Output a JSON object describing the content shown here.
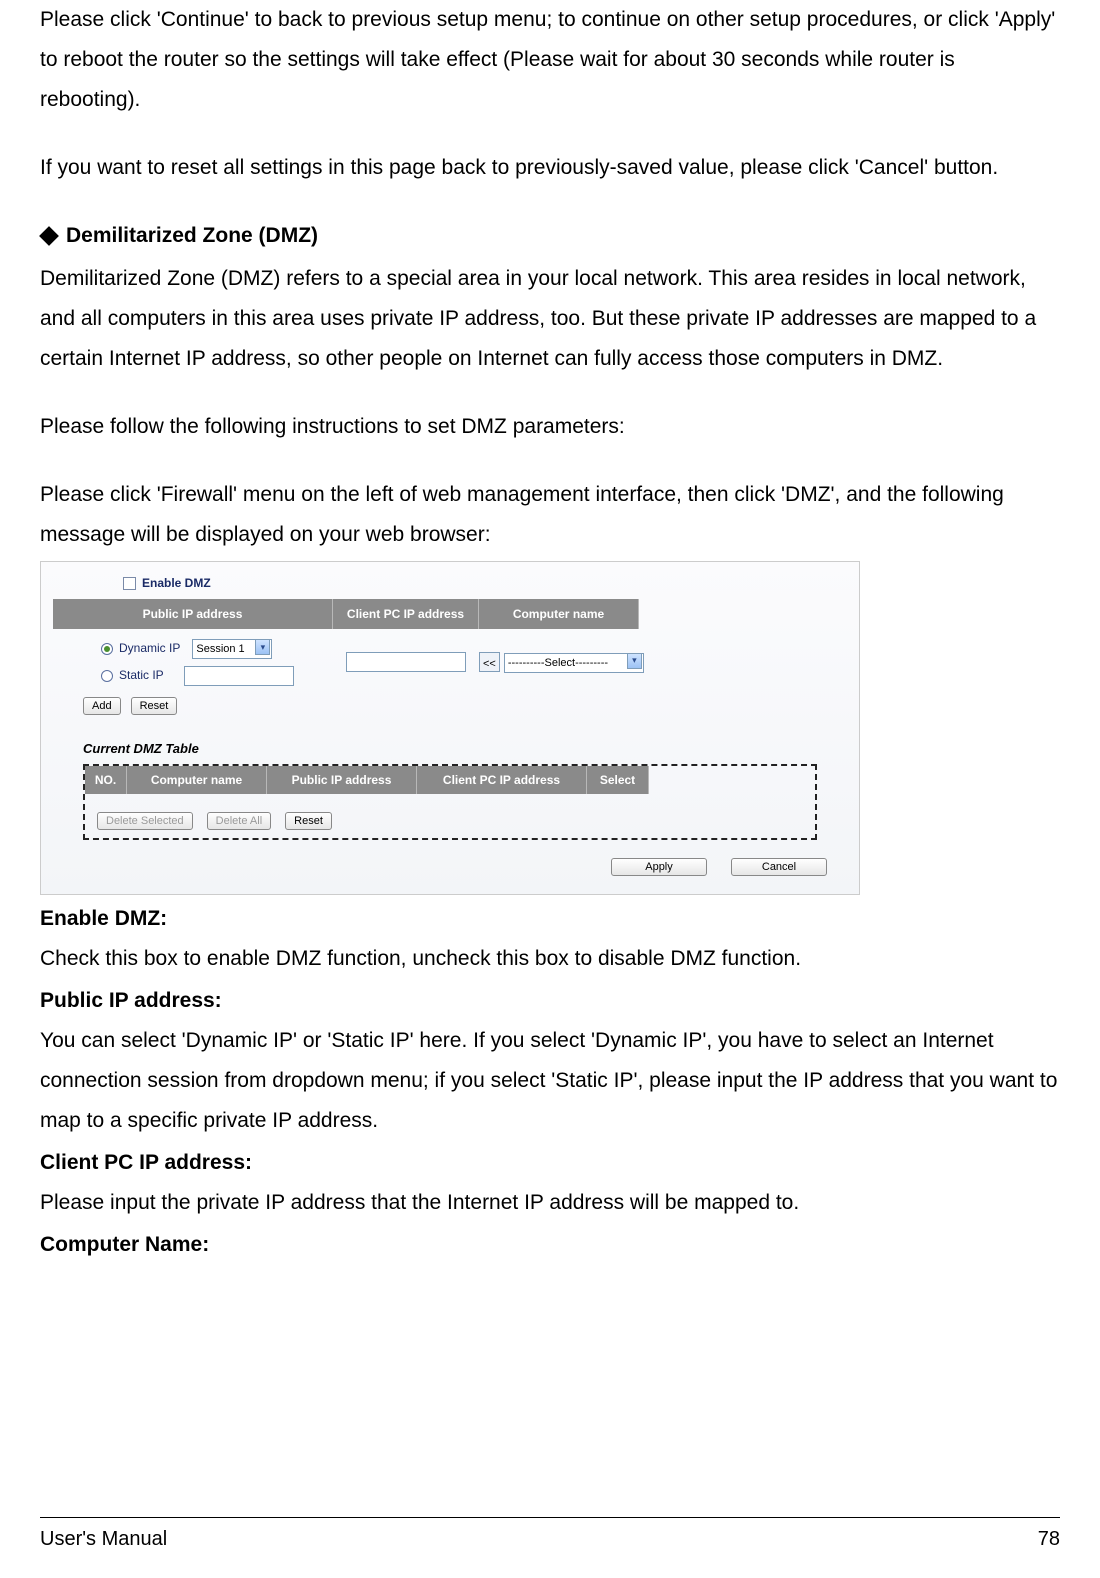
{
  "paragraphs": {
    "p1": "Please click 'Continue' to back to previous setup menu; to continue on other setup procedures, or click 'Apply' to reboot the router so the settings will take effect (Please wait for about 30 seconds while router is rebooting).",
    "p2": "If you want to reset all settings in this page back to previously-saved value, please click 'Cancel' button.",
    "dmz_title": "Demilitarized Zone (DMZ)",
    "dmz_desc": "Demilitarized Zone (DMZ) refers to a special area in your local network. This area resides in local network, and all computers in this area uses private IP address, too. But these private IP addresses are mapped to a certain Internet IP address, so other people on Internet can fully access those computers in DMZ.",
    "dmz_instr1": "Please follow the following instructions to set DMZ parameters:",
    "dmz_instr2": "Please click 'Firewall' menu on the left of web management interface, then click 'DMZ', and the following message will be displayed on your web browser:"
  },
  "screenshot": {
    "enable_label": "Enable DMZ",
    "headers": {
      "public_ip": "Public IP address",
      "client_ip": "Client PC IP address",
      "computer_name": "Computer name"
    },
    "radio_dynamic": "Dynamic IP",
    "radio_static": "Static IP",
    "session_value": "Session 1",
    "select_placeholder": "----------Select---------",
    "arrow_label": "<<",
    "btn_add": "Add",
    "btn_reset": "Reset",
    "table_title": "Current DMZ Table",
    "table_headers": {
      "no": "NO.",
      "cname": "Computer name",
      "pip": "Public IP address",
      "cip": "Client PC IP address",
      "sel": "Select"
    },
    "btn_delete_sel": "Delete Selected",
    "btn_delete_all": "Delete All",
    "btn_reset2": "Reset",
    "btn_apply": "Apply",
    "btn_cancel": "Cancel"
  },
  "fields": {
    "f1_label": "Enable DMZ:",
    "f1_desc": "Check this box to enable DMZ function, uncheck this box to disable DMZ function.",
    "f2_label": "Public IP address:",
    "f2_desc": "You can select 'Dynamic IP' or 'Static IP' here. If you select 'Dynamic IP', you have to select an Internet connection session from dropdown menu; if you select 'Static IP', please input the IP address that you want to map to a specific private IP address.",
    "f3_label": "Client PC IP address:",
    "f3_desc": "Please input the private IP address that the Internet IP address will be mapped to.",
    "f4_label": "Computer Name:"
  },
  "footer": {
    "left": "User's Manual",
    "right": "78"
  }
}
